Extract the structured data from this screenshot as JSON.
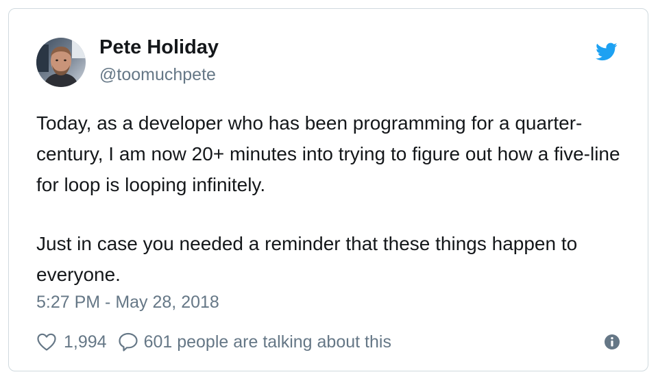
{
  "tweet": {
    "author": {
      "name": "Pete Holiday",
      "handle": "@toomuchpete",
      "avatar_icon": "avatar-photo"
    },
    "text": [
      "Today, as a developer who has been programming for a quarter-century, I am now 20+ minutes into trying to figure out how a five-line for loop is looping infinitely.",
      "Just in case you needed a reminder that these things happen to everyone."
    ],
    "timestamp": "5:27 PM - May 28, 2018",
    "likes": "1,994",
    "conversation": "601 people are talking about this",
    "icons": {
      "brand": "twitter-bird-icon",
      "like": "heart-icon",
      "reply": "speech-bubble-icon",
      "info": "info-icon"
    }
  },
  "colors": {
    "brand": "#1da1f2",
    "text": "#14171a",
    "secondary": "#657786",
    "border": "#cfd9de"
  }
}
